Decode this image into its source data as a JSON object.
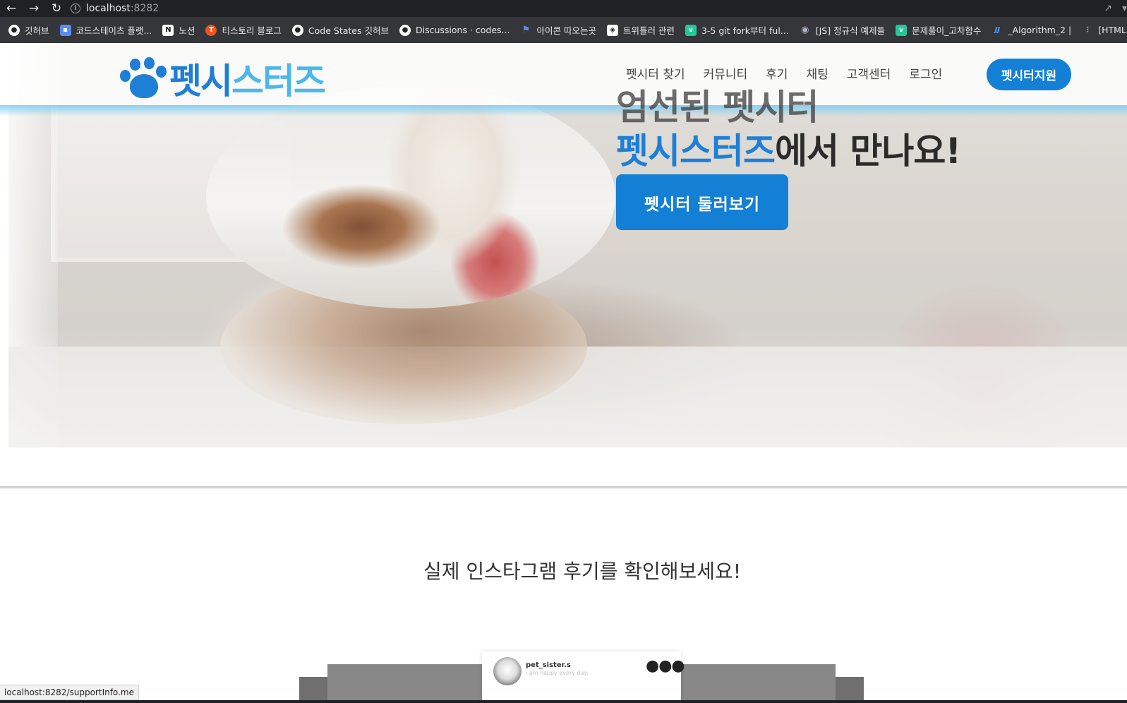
{
  "browser": {
    "url_host": "localhost",
    "url_port": ":8282",
    "back_icon": "arrow-left-icon",
    "forward_icon": "arrow-right-icon",
    "reload_icon": "reload-icon",
    "bookmarks": [
      {
        "label": "깃허브",
        "icon": "github-icon",
        "color": "#ffffff"
      },
      {
        "label": "코드스테이츠 플랫...",
        "icon": "codestates-icon",
        "color": "#5b8def"
      },
      {
        "label": "노션",
        "icon": "notion-icon",
        "color": "#ffffff"
      },
      {
        "label": "티스토리 블로그",
        "icon": "tistory-icon",
        "color": "#eb531f"
      },
      {
        "label": "Code States 깃허브",
        "icon": "github-icon",
        "color": "#ffffff"
      },
      {
        "label": "Discussions · codes...",
        "icon": "github-icon",
        "color": "#ffffff"
      },
      {
        "label": "아이콘 따오는곳",
        "icon": "flag-icon",
        "color": "#5b8def"
      },
      {
        "label": "트위틀러 관련",
        "icon": "codesandbox-icon",
        "color": "#ffffff"
      },
      {
        "label": "3-5 git fork부터 ful...",
        "icon": "velog-icon",
        "color": "#20c997"
      },
      {
        "label": "[JS] 정규식 예제들",
        "icon": "ghost-icon",
        "color": "#aab4c8"
      },
      {
        "label": "문제풀이_고차함수",
        "icon": "velog-icon",
        "color": "#20c997"
      },
      {
        "label": "_Algorithm_2 |",
        "icon": "jj-icon",
        "color": "#4fa3ff"
      },
      {
        "label": "[HTML]",
        "icon": "dots-icon",
        "color": "#9aa0a6"
      }
    ]
  },
  "header": {
    "logo_part1": "펫시",
    "logo_part2": "스터즈",
    "nav": [
      "펫시터 찾기",
      "커뮤니티",
      "후기",
      "채팅",
      "고객센터",
      "로그인"
    ],
    "cta": "펫시터지원"
  },
  "hero": {
    "title_line1": "엄선된 펫시터",
    "title_line2_brand": "펫시스터즈",
    "title_line2_rest": "에서 만나요!",
    "cta": "펫시터 둘러보기"
  },
  "reviews": {
    "heading": "실제 인스타그램 후기를 확인해보세요!",
    "card_username": "pet_sister.s",
    "card_subtext": "i am happy every day.",
    "more_icon": "more-dots-icon"
  },
  "status_url": "localhost:8282/supportInfo.me",
  "colors": {
    "brand_blue": "#1380d6",
    "brand_light_blue": "#4bb7ec"
  }
}
